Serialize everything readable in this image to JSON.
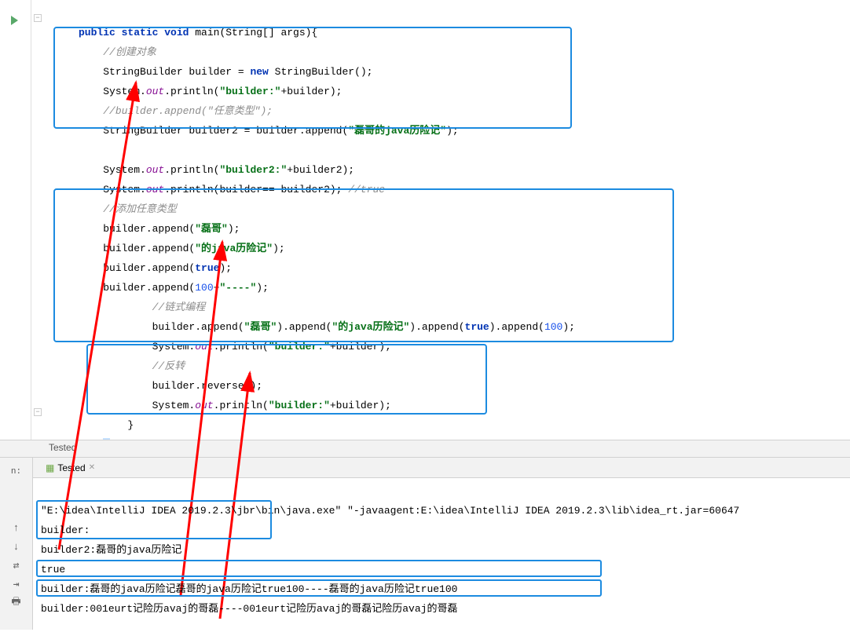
{
  "toolbar": {
    "run_tooltip": "Run"
  },
  "code": {
    "method_sig_pre": "public static void",
    "method_name": " main(String[] args){",
    "comment1": "//创建对象",
    "line1_a": "StringBuilder builder = ",
    "line1_new": "new",
    "line1_b": " StringBuilder();",
    "line2_a": "System.",
    "line2_out": "out",
    "line2_b": ".println(",
    "line2_str": "\"builder:\"",
    "line2_c": "+builder);",
    "comment2": "//builder.append(\"任意类型\");",
    "line3_a": "StringBuilder builder2 = builder.append(",
    "line3_str": "\"磊哥的java历险记\"",
    "line3_b": ");",
    "line4_a": "System.",
    "line4_out": "out",
    "line4_b": ".println(",
    "line4_str": "\"builder2:\"",
    "line4_c": "+builder2);",
    "line5_a": "System.",
    "line5_out": "out",
    "line5_b": ".println(builder== builder2); ",
    "line5_cmt": "//true",
    "comment3": "//添加任意类型",
    "line6_a": "builder.append(",
    "line6_str": "\"磊哥\"",
    "line6_b": ");",
    "line7_a": "builder.append(",
    "line7_str": "\"的java历险记\"",
    "line7_b": ");",
    "line8_a": "builder.append(",
    "line8_true": "true",
    "line8_b": ");",
    "line9_a": "builder.append(",
    "line9_num": "100",
    "line9_b": "+",
    "line9_str": "\"----\"",
    "line9_c": ");",
    "comment4": "//链式编程",
    "line10_a": "builder.append(",
    "line10_s1": "\"磊哥\"",
    "line10_b": ").append(",
    "line10_s2": "\"的java历险记\"",
    "line10_c": ").append(",
    "line10_true": "true",
    "line10_d": ").append(",
    "line10_num": "100",
    "line10_e": ");",
    "line11_a": "System.",
    "line11_out": "out",
    "line11_b": ".println(",
    "line11_str": "\"builder:\"",
    "line11_c": "+builder);",
    "comment5": "//反转",
    "line12": "builder.reverse();",
    "line13_a": "System.",
    "line13_out": "out",
    "line13_b": ".println(",
    "line13_str": "\"builder:\"",
    "line13_c": "+builder);",
    "brace1": "}",
    "brace2": "}"
  },
  "breadcrumb": {
    "label": "Tested"
  },
  "run_panel": {
    "side_label": "n:",
    "tab": "Tested",
    "cmd": "\"E:\\idea\\IntelliJ IDEA 2019.2.3\\jbr\\bin\\java.exe\" \"-javaagent:E:\\idea\\IntelliJ IDEA 2019.2.3\\lib\\idea_rt.jar=60647",
    "out1": "builder:",
    "out2": "builder2:磊哥的java历险记",
    "out3": "true",
    "out4": "builder:磊哥的java历险记磊哥的java历险记true100----磊哥的java历险记true100",
    "out5": "builder:001eurt记险历avaj的哥磊----001eurt记险历avaj的哥磊记险历avaj的哥磊"
  }
}
